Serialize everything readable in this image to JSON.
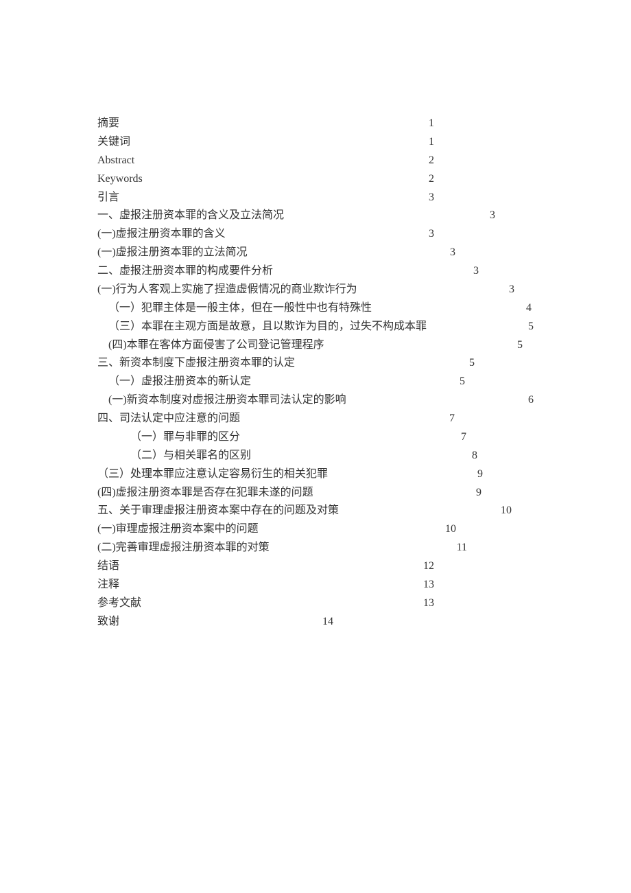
{
  "toc": [
    {
      "label": "摘要",
      "page": "1",
      "indent": 0,
      "pad": 491,
      "latin": false
    },
    {
      "label": "关键词",
      "page": "1",
      "indent": 0,
      "pad": 491,
      "latin": false
    },
    {
      "label": "Abstract",
      "page": "2",
      "indent": 0,
      "pad": 491,
      "latin": true
    },
    {
      "label": "Keywords",
      "page": "2",
      "indent": 0,
      "pad": 491,
      "latin": true
    },
    {
      "label": "引言",
      "page": "3",
      "indent": 0,
      "pad": 491,
      "latin": false
    },
    {
      "label": "一、虚报注册资本罪的含义及立法简况",
      "page": "3",
      "indent": 0,
      "pad": 580,
      "latin": false
    },
    {
      "label": "(一)虚报注册资本罪的含义",
      "page": "3",
      "indent": 0,
      "pad": 491,
      "latin": false
    },
    {
      "label": "(一)虚报注册资本罪的立法简况",
      "page": "3",
      "indent": 0,
      "pad": 522,
      "latin": false
    },
    {
      "label": "二、虚报注册资本罪的构成要件分析",
      "page": "3",
      "indent": 0,
      "pad": 556,
      "latin": false
    },
    {
      "label": "(一)行为人客观上实施了捏造虚假情况的商业欺诈行为",
      "page": "3",
      "indent": 0,
      "pad": 608,
      "latin": false
    },
    {
      "label": "（一）犯罪主体是一般主体，但在一般性中也有特殊性",
      "page": "4",
      "indent": 1,
      "pad": 633,
      "latin": false
    },
    {
      "label": "（三）本罪在主观方面是故意，且以欺诈为目的，过失不构成本罪",
      "page": "5",
      "indent": 1,
      "pad": 692,
      "latin": false
    },
    {
      "label": "(四)本罪在客体方面侵害了公司登记管理程序",
      "page": "5",
      "indent": 1,
      "pad": 620,
      "latin": false
    },
    {
      "label": "三、新资本制度下虚报注册资本罪的认定",
      "page": "5",
      "indent": 0,
      "pad": 550,
      "latin": false
    },
    {
      "label": "（一）虚报注册资本的新认定",
      "page": "5",
      "indent": 1,
      "pad": 536,
      "latin": false
    },
    {
      "label": "(一)新资本制度对虚报注册资本罪司法认定的影响",
      "page": "6",
      "indent": 1,
      "pad": 637,
      "latin": false
    },
    {
      "label": "四、司法认定中应注意的问题",
      "page": "7",
      "indent": 0,
      "pad": 521,
      "latin": false
    },
    {
      "label": "（一）罪与非罪的区分",
      "page": "7",
      "indent": 3,
      "pad": 538,
      "latin": false
    },
    {
      "label": "（二）与相关罪名的区别",
      "page": "8",
      "indent": 3,
      "pad": 554,
      "latin": false
    },
    {
      "label": "（三）处理本罪应注意认定容易衍生的相关犯罪",
      "page": "9",
      "indent": 0,
      "pad": 562,
      "latin": false
    },
    {
      "label": "(四)虚报注册资本罪是否存在犯罪未遂的问题",
      "page": "9",
      "indent": 0,
      "pad": 560,
      "latin": false
    },
    {
      "label": "五、关于审理虚报注册资本案中存在的问题及对策",
      "page": "10",
      "indent": 0,
      "pad": 604,
      "latin": false
    },
    {
      "label": "(一)审理虚报注册资本案中的问题",
      "page": "10",
      "indent": 0,
      "pad": 523,
      "latin": false
    },
    {
      "label": "(二)完善审理虚报注册资本罪的对策",
      "page": "11",
      "indent": 0,
      "pad": 539,
      "latin": false
    },
    {
      "label": "结语",
      "page": "12",
      "indent": 0,
      "pad": 491,
      "latin": false
    },
    {
      "label": "注释",
      "page": "13",
      "indent": 0,
      "pad": 491,
      "latin": false
    },
    {
      "label": "参考文献",
      "page": "13",
      "indent": 0,
      "pad": 491,
      "latin": false
    },
    {
      "label": "致谢",
      "page": "14",
      "indent": 0,
      "pad": 344,
      "latin": false
    }
  ]
}
